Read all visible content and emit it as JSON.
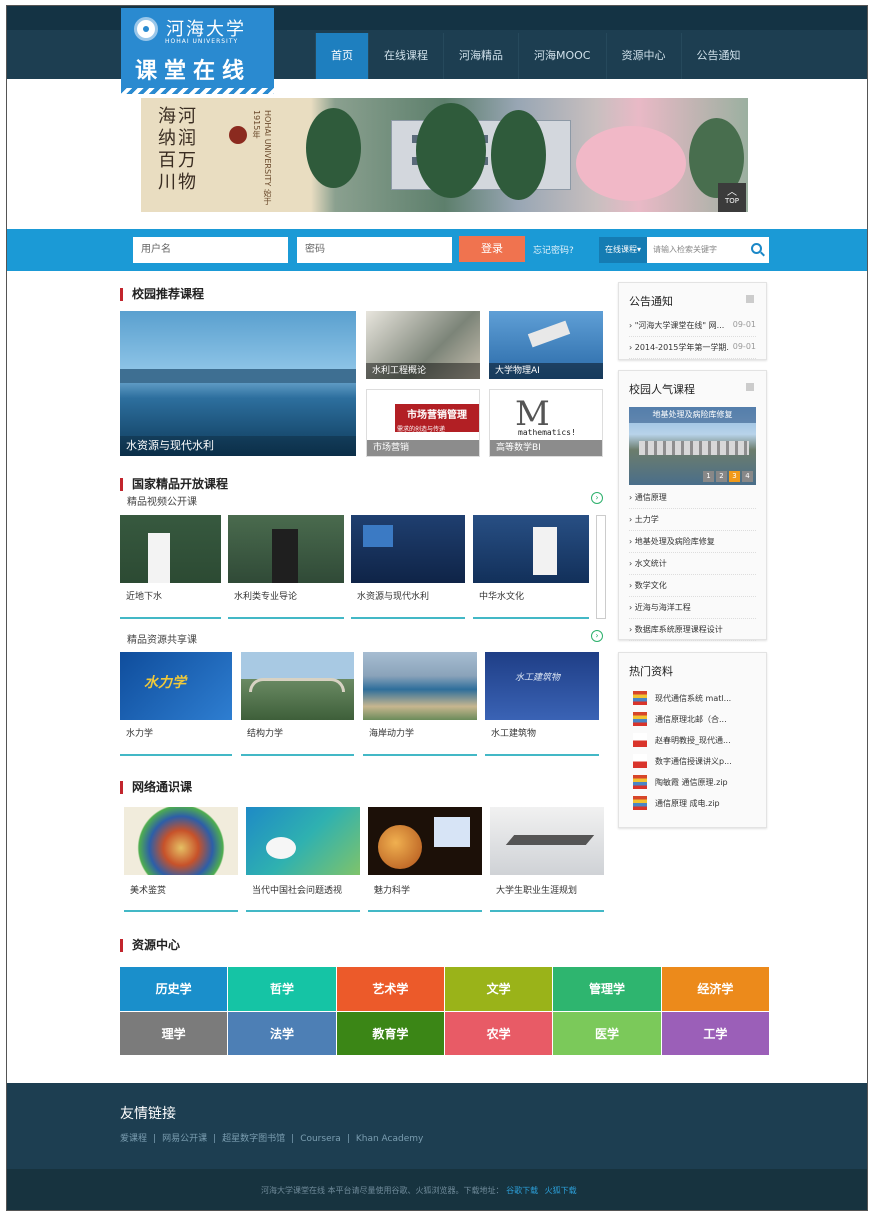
{
  "header": {
    "logo_cn": "河海大学",
    "logo_en": "HOHAI UNIVERSITY",
    "logo_title": "课堂在线",
    "nav": [
      "首页",
      "在线课程",
      "河海精品",
      "河海MOOC",
      "资源中心",
      "公告通知"
    ]
  },
  "banner": {
    "calligraphy": "河润万物 海纳百川",
    "univ": "HOHAI UNIVERSITY 始于1915年",
    "top_label": "TOP"
  },
  "login": {
    "username_placeholder": "用户名",
    "password_placeholder": "密码",
    "login_label": "登录",
    "forgot_label": "忘记密码?",
    "search_type": "在线课程▾",
    "search_placeholder": "请输入检索关键字"
  },
  "campus": {
    "title": "校园推荐课程",
    "tiles": [
      "水资源与现代水利",
      "水利工程概论",
      "大学物理AI",
      "市场营销",
      "高等数学BI"
    ],
    "market_text": "市场营销管理",
    "market_sub": "需求的创造与传递",
    "math_text": "mathematics!"
  },
  "national": {
    "title": "国家精品开放课程",
    "video_title": "精品视频公开课",
    "videos": [
      "近地下水",
      "水利类专业导论",
      "水资源与现代水利",
      "中华水文化"
    ],
    "share_title": "精品资源共享课",
    "shares": [
      "水力学",
      "结构力学",
      "海岸动力学",
      "水工建筑物"
    ]
  },
  "general": {
    "title": "网络通识课",
    "items": [
      "美术鉴赏",
      "当代中国社会问题透视",
      "魅力科学",
      "大学生职业生涯规划"
    ]
  },
  "resource": {
    "title": "资源中心",
    "items": [
      {
        "label": "历史学",
        "color": "#1a8fcb"
      },
      {
        "label": "哲学",
        "color": "#15c4a5"
      },
      {
        "label": "艺术学",
        "color": "#ec5a2a"
      },
      {
        "label": "文学",
        "color": "#9ab319"
      },
      {
        "label": "管理学",
        "color": "#2eb56f"
      },
      {
        "label": "经济学",
        "color": "#ec8a1b"
      },
      {
        "label": "理学",
        "color": "#7b7b7b"
      },
      {
        "label": "法学",
        "color": "#4d7fb5"
      },
      {
        "label": "教育学",
        "color": "#3b8616"
      },
      {
        "label": "农学",
        "color": "#e85b66"
      },
      {
        "label": "医学",
        "color": "#7bc95a"
      },
      {
        "label": "工学",
        "color": "#9b5fb8"
      }
    ]
  },
  "sidebar": {
    "notice_title": "公告通知",
    "notices": [
      {
        "text": "\"河海大学课堂在线\" 网...",
        "date": "09-01"
      },
      {
        "text": "2014-2015学年第一学期...",
        "date": "09-01"
      }
    ],
    "popular_title": "校园人气课程",
    "popular_caption": "地基处理及病险库修复",
    "pages": [
      "1",
      "2",
      "3",
      "4"
    ],
    "popular": [
      "通信原理",
      "土力学",
      "地基处理及病险库修复",
      "水文统计",
      "数学文化",
      "近海与海洋工程",
      "数据库系统原理课程设计"
    ],
    "hot_title": "热门资料",
    "files": [
      {
        "name": "现代通信系统 matl...",
        "type": "RAR"
      },
      {
        "name": "通信原理北邮（合...",
        "type": "RAR"
      },
      {
        "name": "赵春明教授_现代通...",
        "type": "PDF"
      },
      {
        "name": "数字通信授课讲义p...",
        "type": "PDF"
      },
      {
        "name": "陶敏霞 通信原理.zip",
        "type": "RAR"
      },
      {
        "name": "通信原理 成电.zip",
        "type": "RAR"
      }
    ]
  },
  "footer": {
    "links_title": "友情链接",
    "links": [
      "爱课程",
      "|",
      "网易公开课",
      "|",
      "超星数字图书馆",
      "|",
      "Coursera",
      "|",
      "Khan Academy"
    ],
    "notice": "河海大学课堂在线    本平台请尽量使用谷歌、火狐浏览器。下载地址：",
    "chrome": "谷歌下载",
    "firefox": "火狐下载"
  }
}
